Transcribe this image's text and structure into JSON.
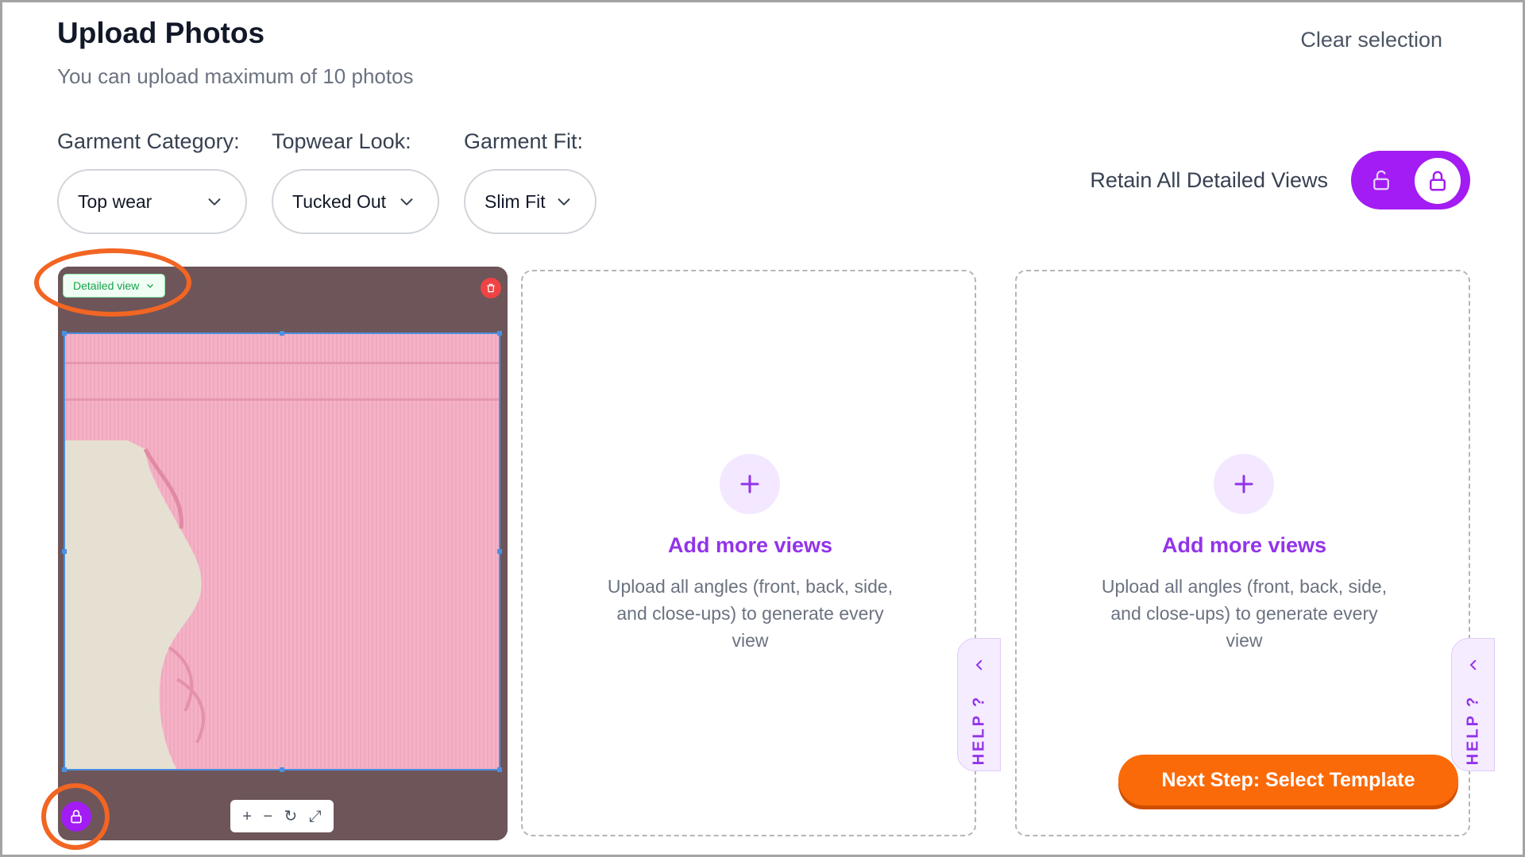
{
  "header": {
    "title": "Upload Photos",
    "subtitle": "You can upload maximum of 10 photos",
    "clear_selection": "Clear selection"
  },
  "filters": {
    "garment_category": {
      "label": "Garment Category:",
      "value": "Top wear"
    },
    "topwear_look": {
      "label": "Topwear Look:",
      "value": "Tucked Out"
    },
    "garment_fit": {
      "label": "Garment Fit:",
      "value": "Slim Fit"
    }
  },
  "retain": {
    "label": "Retain All Detailed Views",
    "locked": true
  },
  "photo_card": {
    "view_tag": "Detailed view",
    "zoom_controls": [
      "+",
      "−",
      "↻",
      "⤢"
    ]
  },
  "upload_cards": [
    {
      "title": "Add more views",
      "description": "Upload all angles (front, back, side, and close-ups) to generate every view"
    },
    {
      "title": "Add more views",
      "description": "Upload all angles (front, back, side, and close-ups) to generate every view"
    }
  ],
  "help_label": "HELP ?",
  "next_button": "Next Step: Select Template",
  "colors": {
    "accent_purple": "#a21cf3",
    "cta_orange": "#fb6a09",
    "annotation_orange": "#f26522",
    "delete_red": "#ef4444"
  }
}
